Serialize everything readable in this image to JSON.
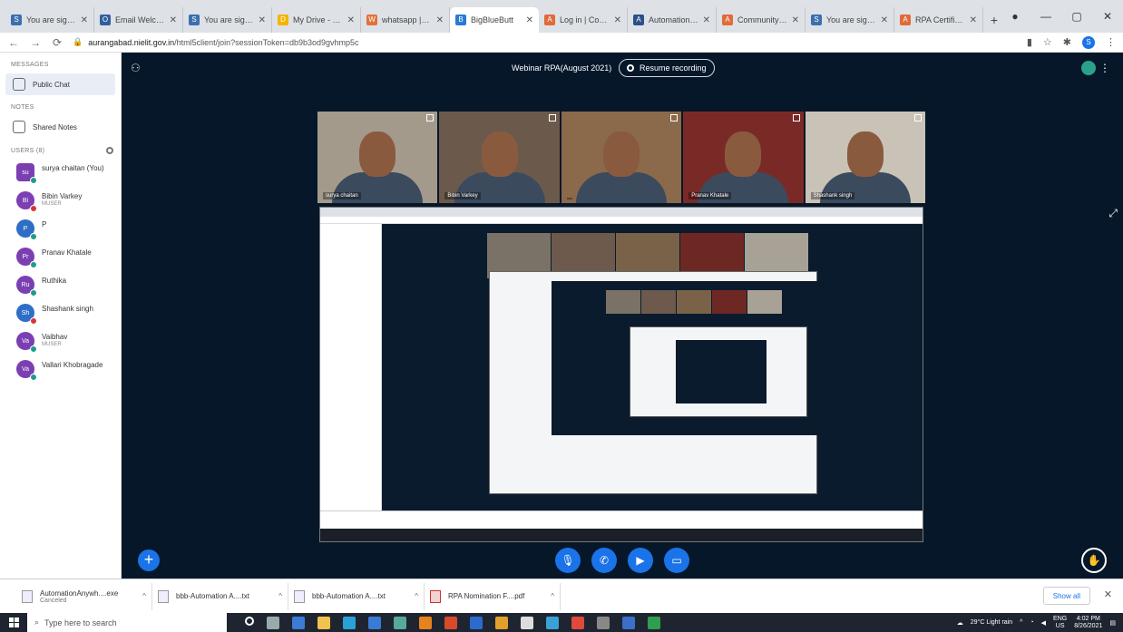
{
  "browser": {
    "tabs": [
      {
        "label": "You are signed",
        "fav": "S",
        "fav_color": "#3a6fb0"
      },
      {
        "label": "Email Welcome",
        "fav": "O",
        "fav_color": "#2f5fa0"
      },
      {
        "label": "You are signed",
        "fav": "S",
        "fav_color": "#3a6fb0"
      },
      {
        "label": "My Drive - Goo",
        "fav": "D",
        "fav_color": "#f4b400"
      },
      {
        "label": "whatsapp | Edi",
        "fav": "W",
        "fav_color": "#e0733a"
      },
      {
        "label": "BigBlueButt",
        "fav": "B",
        "fav_color": "#2a7ad3",
        "active": true
      },
      {
        "label": "Log in | Control",
        "fav": "A",
        "fav_color": "#e06a3a"
      },
      {
        "label": "Automation Arc",
        "fav": "A",
        "fav_color": "#2d4f8a"
      },
      {
        "label": "Community Edi",
        "fav": "A",
        "fav_color": "#e06a3a"
      },
      {
        "label": "You are signed",
        "fav": "S",
        "fav_color": "#3a6fb0"
      },
      {
        "label": "RPA Certificatio",
        "fav": "A",
        "fav_color": "#e06a3a"
      }
    ],
    "url_host": "aurangabad.nielit.gov.in",
    "url_path": "/html5client/join?sessionToken=db9b3od9gvhmp5c"
  },
  "sidebar": {
    "messages_label": "MESSAGES",
    "public_chat": "Public Chat",
    "notes_label": "NOTES",
    "shared_notes": "Shared Notes",
    "users_label": "USERS (8)",
    "users": [
      {
        "initials": "su",
        "name": "surya chaitan (You)",
        "sub": "",
        "square": true,
        "dot": "green",
        "color": "#7b3fb2"
      },
      {
        "initials": "Bi",
        "name": "Bibin Varkey",
        "sub": "MUSER",
        "square": false,
        "dot": "red",
        "color": "#7b3fb2"
      },
      {
        "initials": "P",
        "name": "P",
        "sub": "",
        "square": false,
        "dot": "green",
        "color": "#2f6ec7"
      },
      {
        "initials": "Pr",
        "name": "Pranav Khatale",
        "sub": "",
        "square": false,
        "dot": "green",
        "color": "#7b3fb2"
      },
      {
        "initials": "Ru",
        "name": "Ruthika",
        "sub": "",
        "square": false,
        "dot": "green",
        "color": "#7b3fb2"
      },
      {
        "initials": "Sh",
        "name": "Shashank singh",
        "sub": "",
        "square": false,
        "dot": "red",
        "color": "#2f6ec7"
      },
      {
        "initials": "Va",
        "name": "Vaibhav",
        "sub": "MUSER",
        "square": false,
        "dot": "green",
        "color": "#7b3fb2"
      },
      {
        "initials": "Va",
        "name": "Vallari Khobragade",
        "sub": "",
        "square": false,
        "dot": "green",
        "color": "#7b3fb2"
      }
    ]
  },
  "meeting": {
    "title": "Webinar RPA(August 2021)",
    "record_label": "Resume recording",
    "videos": [
      {
        "name": "surya chaitan",
        "bg": "#a39a8c"
      },
      {
        "name": "Bibin Varkey",
        "bg": "#6b5a4c"
      },
      {
        "name": "",
        "bg": "#8a6a4a"
      },
      {
        "name": "Pranav Khatale",
        "bg": "#7a2a26"
      },
      {
        "name": "Shashank singh",
        "bg": "#c9c3b7"
      }
    ]
  },
  "downloads": {
    "items": [
      {
        "name": "AutomationAnywh....exe",
        "sub": "Canceled",
        "type": "exe"
      },
      {
        "name": "bbb-Automation A....txt",
        "sub": "",
        "type": "txt"
      },
      {
        "name": "bbb-Automation A....txt",
        "sub": "",
        "type": "txt"
      },
      {
        "name": "RPA Nomination F....pdf",
        "sub": "",
        "type": "pdf"
      }
    ],
    "show_all": "Show all"
  },
  "taskbar": {
    "search_placeholder": "Type here to search",
    "weather": "29°C Light rain",
    "lang": "ENG",
    "lang_sub": "US",
    "time": "4:02 PM",
    "date": "8/26/2021"
  }
}
